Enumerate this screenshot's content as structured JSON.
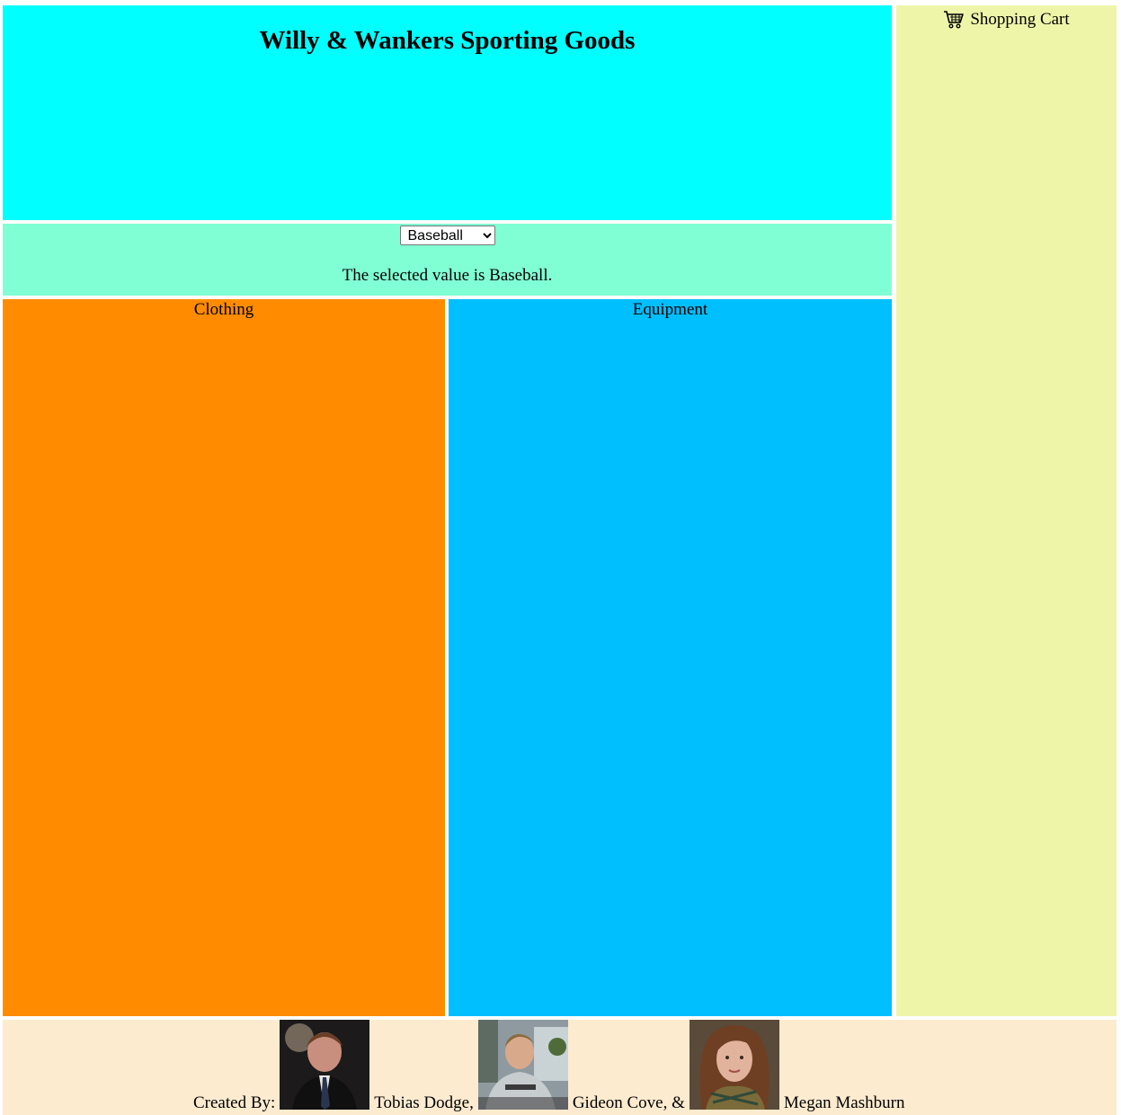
{
  "header": {
    "title": "Willy & Wankers Sporting Goods",
    "background": "#00ffff"
  },
  "cart": {
    "label": "Shopping Cart",
    "icon": "shopping-cart-icon",
    "background": "#eef5a9"
  },
  "selector": {
    "selected_value": "Baseball",
    "options": [
      "Baseball"
    ],
    "selected_text": "The selected value is Baseball.",
    "background": "#80ffd4"
  },
  "sections": {
    "clothing": {
      "label": "Clothing",
      "background": "#ff8c00"
    },
    "equipment": {
      "label": "Equipment",
      "background": "#00bfff"
    }
  },
  "footer": {
    "created_by": "Created By:",
    "authors": [
      {
        "name": "Tobias Dodge,",
        "photo": "author-photo"
      },
      {
        "name": "Gideon Cove, &",
        "photo": "author-photo"
      },
      {
        "name": "Megan Mashburn",
        "photo": "author-photo"
      }
    ],
    "background": "#fdebd0"
  }
}
